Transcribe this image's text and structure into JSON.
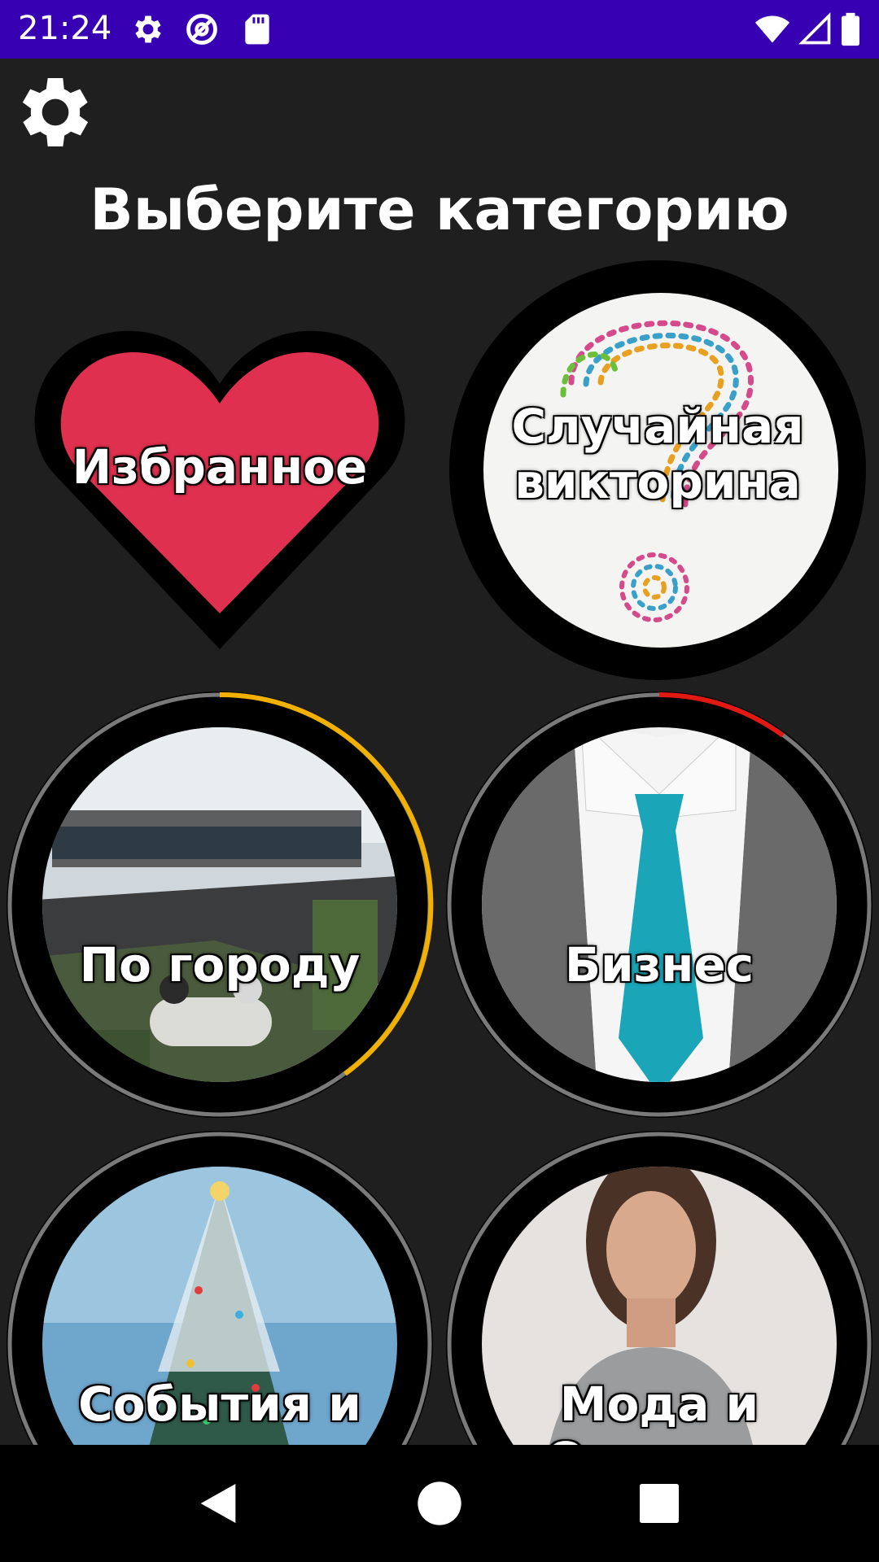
{
  "status_bar": {
    "time": "21:24",
    "icons": [
      "gear-icon",
      "at-sign-icon",
      "sd-card-icon",
      "wifi-icon",
      "signal-icon",
      "battery-icon"
    ]
  },
  "header": {
    "settings_icon": "gear-icon",
    "title": "Выберите категорию"
  },
  "categories": [
    {
      "label": "Избранное",
      "shape": "heart",
      "color": "#e0304f"
    },
    {
      "label_line1": "Случайная",
      "label_line2": "викторина",
      "shape": "circle"
    },
    {
      "label": "По городу",
      "shape": "circle",
      "progress_color": "#f2b100"
    },
    {
      "label": "Бизнес",
      "shape": "circle",
      "progress_color": "#e01a12"
    },
    {
      "label": "События и случаи",
      "shape": "circle"
    },
    {
      "label": "Мода и Одежда",
      "shape": "circle"
    }
  ],
  "nav_bar": {
    "back": "back-triangle-icon",
    "home": "home-circle-icon",
    "recents": "recents-square-icon"
  },
  "colors": {
    "status_bar": "#3700b3",
    "background": "#1f1f1f",
    "heart": "#e0304f"
  }
}
